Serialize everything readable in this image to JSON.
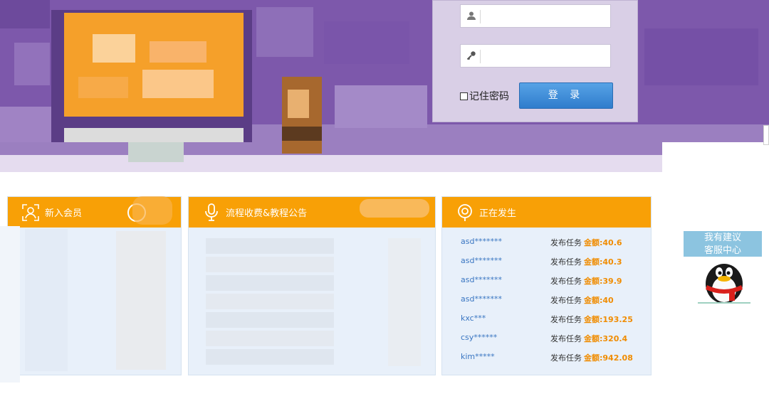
{
  "login": {
    "username_placeholder": "",
    "password_placeholder": "",
    "remember_label": "记住密码",
    "login_button": "登 录",
    "user_icon": "user-icon",
    "key_icon": "key-icon"
  },
  "panels": {
    "new_members": {
      "title": "新入会员",
      "icon": "member-icon"
    },
    "announcements": {
      "title": "流程收费&教程公告",
      "icon": "microphone-icon"
    },
    "happening": {
      "title": "正在发生",
      "icon": "location-pin-icon",
      "rows": [
        {
          "name": "asd*******",
          "action": "发布任务",
          "amount": "金额:40.6"
        },
        {
          "name": "asd*******",
          "action": "发布任务",
          "amount": "金额:40.3"
        },
        {
          "name": "asd*******",
          "action": "发布任务",
          "amount": "金额:39.9"
        },
        {
          "name": "asd*******",
          "action": "发布任务",
          "amount": "金额:40"
        },
        {
          "name": "kxc***",
          "action": "发布任务",
          "amount": "金额:193.25"
        },
        {
          "name": "csy******",
          "action": "发布任务",
          "amount": "金额:320.4"
        },
        {
          "name": "kim*****",
          "action": "发布任务",
          "amount": "金额:942.08"
        }
      ]
    }
  },
  "widget": {
    "suggest": "我有建议",
    "service": "客服中心",
    "avatar_icon": "qq-penguin-icon"
  },
  "colors": {
    "banner_purple": "#7d58ab",
    "panel_orange": "#f8a006",
    "link_blue": "#3a76c2",
    "amount_orange": "#f08c00",
    "button_blue": "#2f7ccc"
  }
}
